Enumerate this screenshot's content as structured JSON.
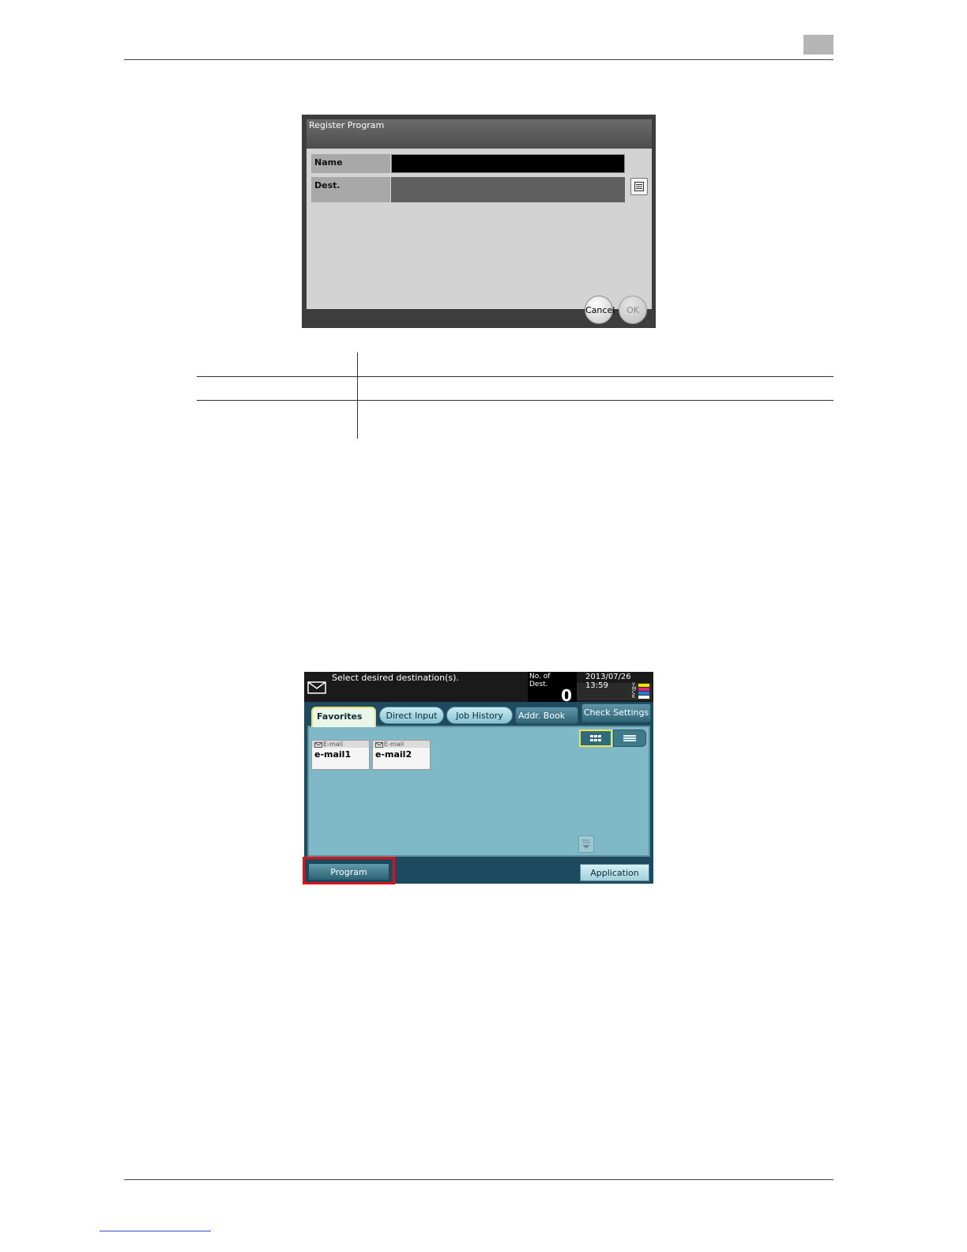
{
  "register_screen": {
    "title": "Register Program",
    "name_label": "Name",
    "dest_label": "Dest.",
    "list_icon": "list-icon",
    "cancel_label": "Cancel",
    "ok_label": "OK"
  },
  "destination_screen": {
    "message": "Select desired destination(s).",
    "dest_count_label_1": "No. of",
    "dest_count_label_2": "Dest.",
    "dest_count": "0",
    "datetime": "2013/07/26 13:59",
    "toner_labels": [
      "Y",
      "M",
      "C",
      "K"
    ],
    "toner_colors": [
      "#f4e300",
      "#e0207a",
      "#1d7fd8",
      "#ffffff"
    ],
    "tabs": [
      "Favorites",
      "Direct Input",
      "Job History",
      "Addr. Book"
    ],
    "check_settings_label": "Check Settings",
    "cards": [
      {
        "type": "E-mail",
        "name": "e-mail1"
      },
      {
        "type": "E-mail",
        "name": "e-mail2"
      }
    ],
    "program_label": "Program",
    "application_label": "Application",
    "highlight_color": "#d9121b"
  }
}
